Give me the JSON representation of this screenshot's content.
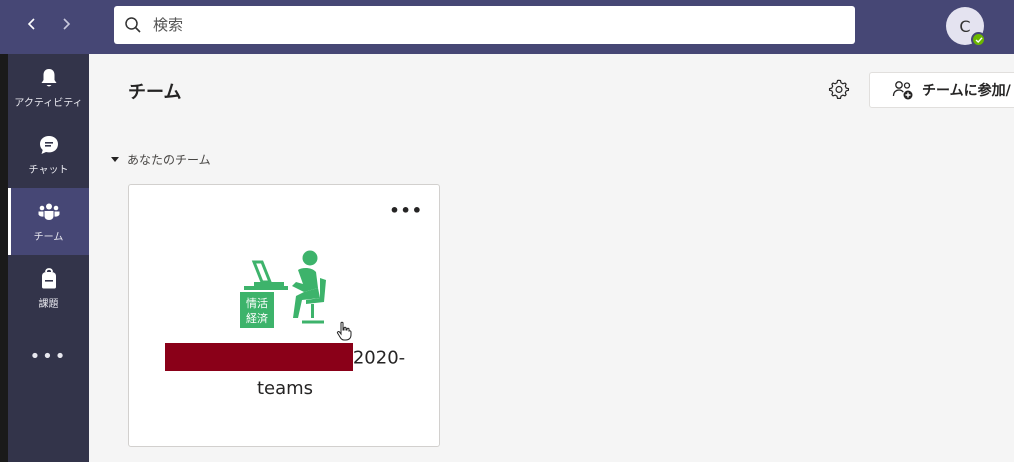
{
  "nav": {
    "back_icon": "chevron-left-icon",
    "forward_icon": "chevron-right-icon"
  },
  "search": {
    "placeholder": "検索"
  },
  "user": {
    "initial": "C",
    "presence": "available"
  },
  "rail": {
    "items": [
      {
        "label": "アクティビティ",
        "icon": "bell-icon",
        "active": false
      },
      {
        "label": "チャット",
        "icon": "chat-icon",
        "active": false
      },
      {
        "label": "チーム",
        "icon": "teams-icon",
        "active": true
      },
      {
        "label": "課題",
        "icon": "backpack-icon",
        "active": false
      }
    ],
    "more_label": "•••"
  },
  "main": {
    "title": "チーム",
    "join_label": "チームに参加/",
    "section_label": "あなたのチーム",
    "teams": [
      {
        "name_suffix": "2020-",
        "name_line2": "teams",
        "logo_text_line1": "情活",
        "logo_text_line2": "経済",
        "more_label": "•••"
      }
    ]
  },
  "colors": {
    "topbar": "#464775",
    "rail": "#33344a",
    "logo_green": "#3db36b",
    "redaction": "#8a0018"
  }
}
